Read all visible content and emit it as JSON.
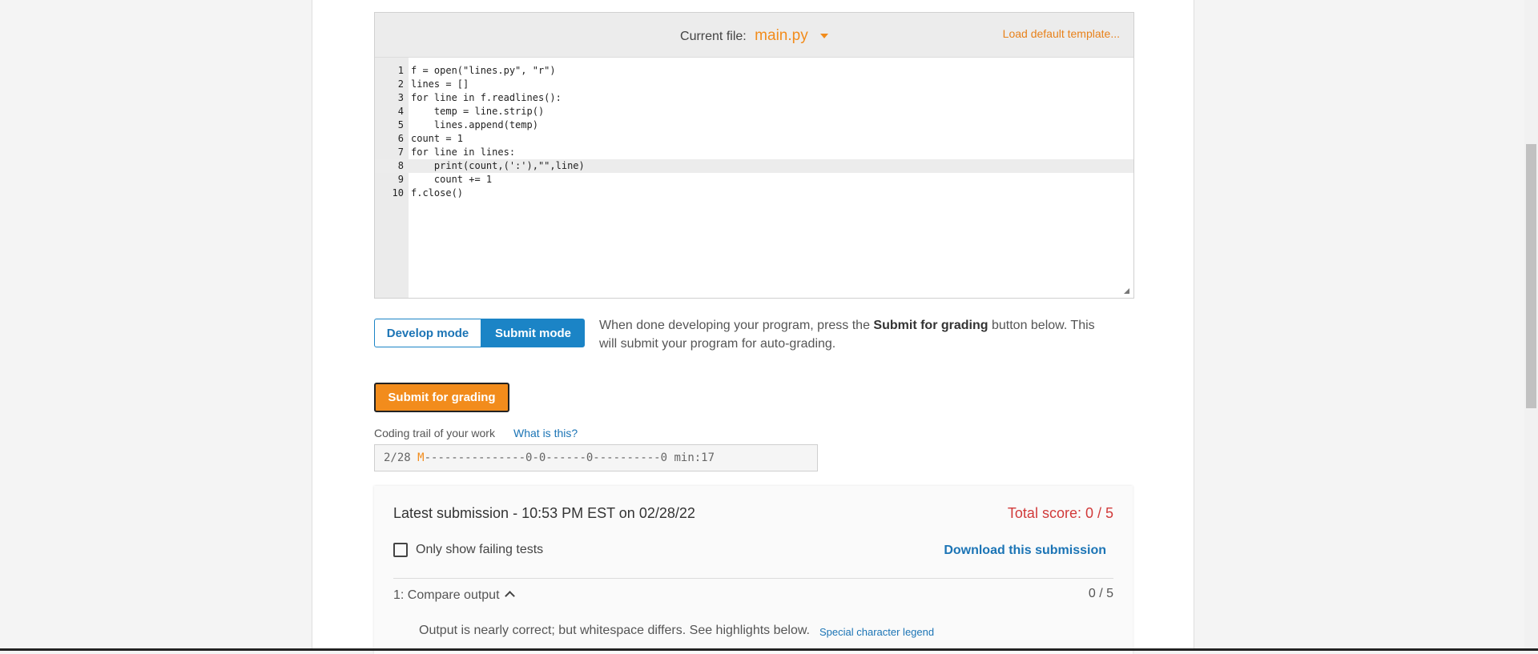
{
  "editor": {
    "current_file_label": "Current file:",
    "file_name": "main.py",
    "load_template": "Load default template...",
    "lines": [
      {
        "n": "1",
        "code": "f = open(\"lines.py\", \"r\")"
      },
      {
        "n": "2",
        "code": "lines = []"
      },
      {
        "n": "3",
        "code": "for line in f.readlines():"
      },
      {
        "n": "4",
        "code": "    temp = line.strip()"
      },
      {
        "n": "5",
        "code": "    lines.append(temp)"
      },
      {
        "n": "6",
        "code": "count = 1"
      },
      {
        "n": "7",
        "code": "for line in lines:"
      },
      {
        "n": "8",
        "code": "    print(count,(':'),\"\",line)"
      },
      {
        "n": "9",
        "code": "    count += 1"
      },
      {
        "n": "10",
        "code": "f.close()"
      }
    ]
  },
  "mode": {
    "develop": "Develop mode",
    "submit": "Submit mode",
    "desc_before": "When done developing your program, press the ",
    "desc_bold": "Submit for grading",
    "desc_after": " button below. This will submit your program for auto-grading."
  },
  "submit_button": "Submit for grading",
  "trail": {
    "label": "Coding trail of your work",
    "help": "What is this?",
    "prefix": "2/28 ",
    "marker": "M",
    "rest": "---------------0-0------0----------0 min:17"
  },
  "submission": {
    "title": "Latest submission - 10:53 PM EST on 02/28/22",
    "total_score": "Total score: 0 / 5",
    "filter_label": "Only show failing tests",
    "download": "Download this submission",
    "test_name": "1: Compare output",
    "test_score": "0 / 5",
    "output_note": "Output is nearly correct; but whitespace differs. See highlights below.",
    "legend_link": "Special character legend"
  },
  "colors": {
    "accent_orange": "#f28c1c",
    "link_blue": "#1b74b5",
    "error_red": "#d13a3a"
  }
}
